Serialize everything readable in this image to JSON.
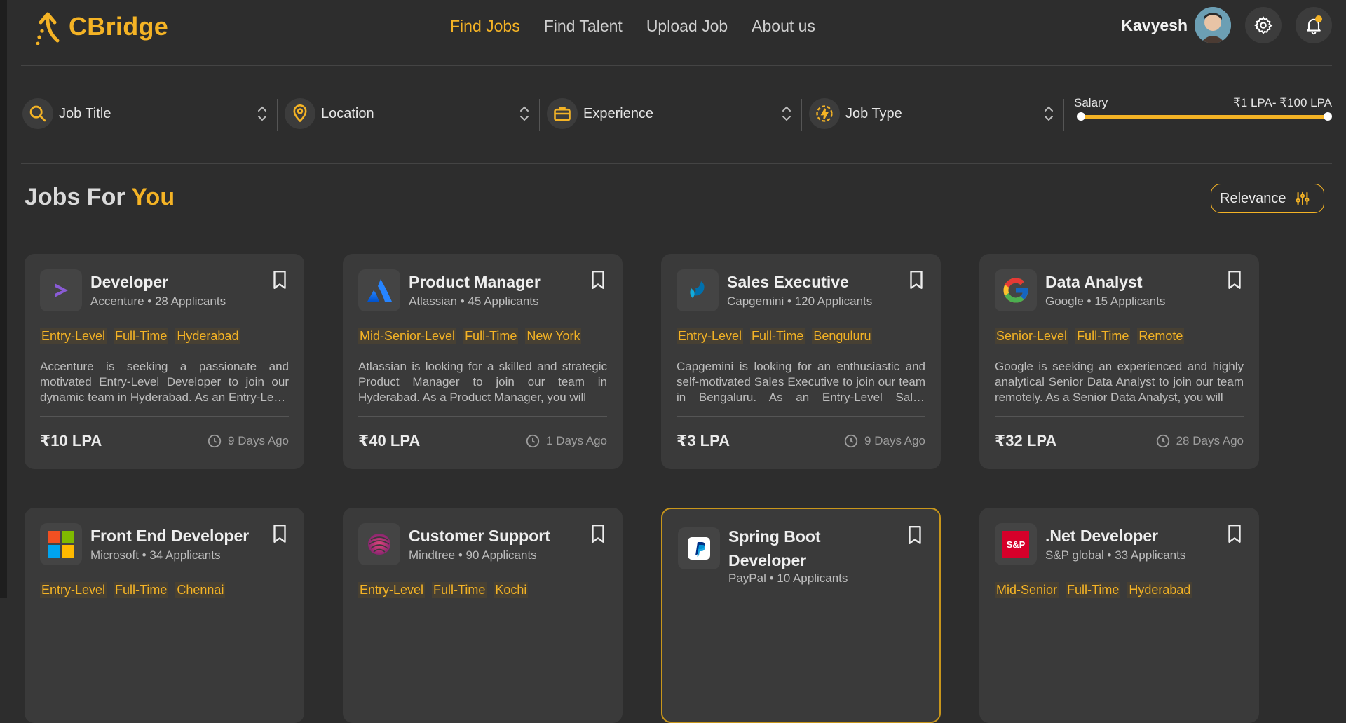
{
  "brand": {
    "name": "CBridge"
  },
  "nav": {
    "items": [
      {
        "label": "Find Jobs",
        "active": true
      },
      {
        "label": "Find Talent"
      },
      {
        "label": "Upload Job"
      },
      {
        "label": "About us"
      }
    ]
  },
  "user": {
    "name": "Kavyesh"
  },
  "filters": {
    "job_title": "Job Title",
    "location": "Location",
    "experience": "Experience",
    "job_type": "Job Type",
    "salary_label": "Salary",
    "salary_range": "₹1 LPA- ₹100 LPA"
  },
  "section": {
    "title_part1": "Jobs For ",
    "title_part2": "You",
    "sort_label": "Relevance"
  },
  "colors": {
    "accent": "#f4b325",
    "background": "#2d2d2d",
    "card": "#3a3a3a"
  },
  "jobs": [
    {
      "title": "Developer",
      "company_line": "Accenture • 28 Applicants",
      "tags": [
        "Entry-Level",
        "Full-Time",
        "Hyderabad"
      ],
      "description": "Accenture is seeking a passionate and motivated Entry-Level Developer to join our dynamic team in Hyderabad. As an Entry-Level Developer, you will",
      "salary": "₹10 LPA",
      "posted": "9 Days Ago",
      "logo": "accenture-logo"
    },
    {
      "title": "Product Manager",
      "company_line": "Atlassian • 45 Applicants",
      "tags": [
        "Mid-Senior-Level",
        "Full-Time",
        "New York"
      ],
      "description": "Atlassian is looking for a skilled and strategic Product Manager to join our team in Hyderabad. As a Product Manager, you will",
      "salary": "₹40 LPA",
      "posted": "1 Days Ago",
      "logo": "atlassian-logo"
    },
    {
      "title": "Sales Executive",
      "company_line": "Capgemini • 120 Applicants",
      "tags": [
        "Entry-Level",
        "Full-Time",
        "Benguluru"
      ],
      "description": "Capgemini is looking for an enthusiastic and self-motivated Sales Executive to join our team in Bengaluru. As an Entry-Level Sales Executive, you will",
      "salary": "₹3 LPA",
      "posted": "9 Days Ago",
      "logo": "capgemini-logo"
    },
    {
      "title": "Data Analyst",
      "company_line": "Google • 15 Applicants",
      "tags": [
        "Senior-Level",
        "Full-Time",
        "Remote"
      ],
      "description": "Google is seeking an experienced and highly analytical Senior Data Analyst to join our team remotely. As a Senior Data Analyst, you will",
      "salary": "₹32 LPA",
      "posted": "28 Days Ago",
      "logo": "google-logo"
    },
    {
      "title": "Front End Developer",
      "company_line": "Microsoft • 34 Applicants",
      "tags": [
        "Entry-Level",
        "Full-Time",
        "Chennai"
      ],
      "description": "",
      "salary": "",
      "posted": "",
      "logo": "microsoft-logo"
    },
    {
      "title": "Customer Support",
      "company_line": "Mindtree • 90 Applicants",
      "tags": [
        "Entry-Level",
        "Full-Time",
        "Kochi"
      ],
      "description": "",
      "salary": "",
      "posted": "",
      "logo": "mindtree-logo"
    },
    {
      "title": "Spring Boot Developer",
      "company_line": "PayPal • 10 Applicants",
      "tags": [],
      "description": "",
      "salary": "",
      "posted": "",
      "logo": "paypal-logo"
    },
    {
      "title": ".Net Developer",
      "company_line": "S&P global • 33 Applicants",
      "tags": [
        "Mid-Senior",
        "Full-Time",
        "Hyderabad"
      ],
      "description": "",
      "salary": "",
      "posted": "",
      "logo": "sp-global-logo",
      "logo_text": "S&P"
    }
  ]
}
